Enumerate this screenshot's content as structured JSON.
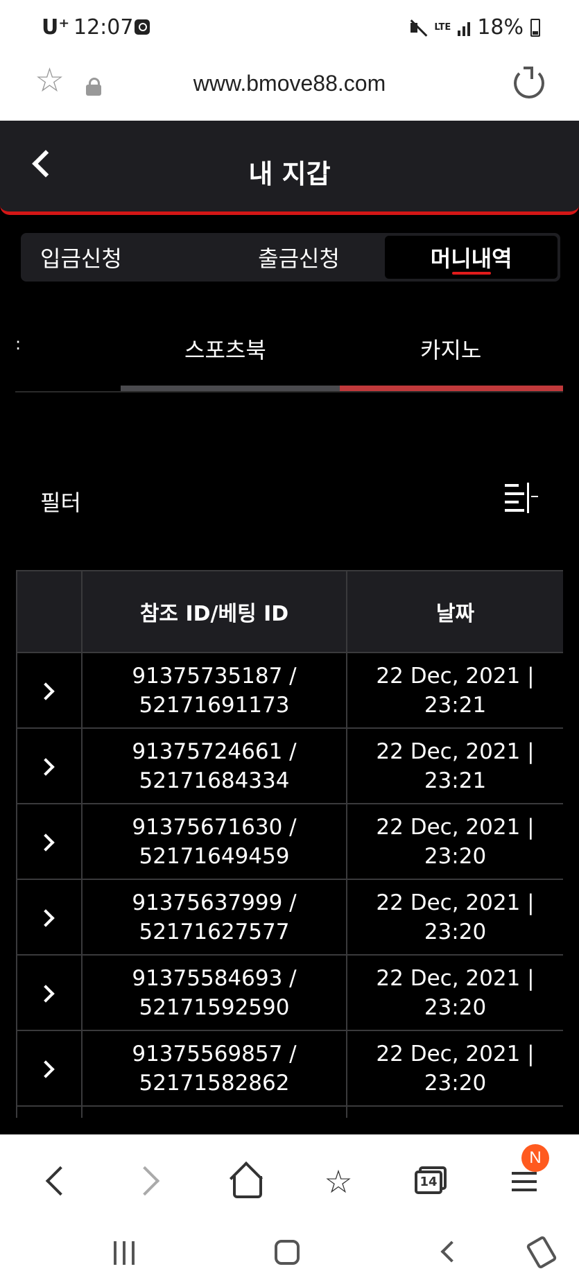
{
  "status_bar": {
    "carrier": "U⁺",
    "time": "12:07",
    "network": "LTE",
    "battery": "18%"
  },
  "url_bar": {
    "url": "www.bmove88.com"
  },
  "header": {
    "title": "내 지갑"
  },
  "tabs": [
    {
      "label": "입금신청",
      "active": false
    },
    {
      "label": "출금신청",
      "active": false
    },
    {
      "label": "머니내역",
      "active": true
    }
  ],
  "sub_tabs": [
    {
      "label": ":",
      "active": false
    },
    {
      "label": "스포츠북",
      "active": false
    },
    {
      "label": "카지노",
      "active": true
    }
  ],
  "filter": {
    "label": "필터"
  },
  "table": {
    "headers": [
      "",
      "참조 ID/베팅 ID",
      "날짜"
    ],
    "rows": [
      {
        "ref_id": "91375735187 /",
        "bet_id": "52171691173",
        "date": "22 Dec, 2021 |",
        "time": "23:21"
      },
      {
        "ref_id": "91375724661 /",
        "bet_id": "52171684334",
        "date": "22 Dec, 2021 |",
        "time": "23:21"
      },
      {
        "ref_id": "91375671630 /",
        "bet_id": "52171649459",
        "date": "22 Dec, 2021 |",
        "time": "23:20"
      },
      {
        "ref_id": "91375637999 /",
        "bet_id": "52171627577",
        "date": "22 Dec, 2021 |",
        "time": "23:20"
      },
      {
        "ref_id": "91375584693 /",
        "bet_id": "52171592590",
        "date": "22 Dec, 2021 |",
        "time": "23:20"
      },
      {
        "ref_id": "91375569857 /",
        "bet_id": "52171582862",
        "date": "22 Dec, 2021 |",
        "time": "23:20"
      }
    ]
  },
  "browser_nav": {
    "tab_count": "14",
    "notification_badge": "N"
  },
  "colors": {
    "accent_red": "#d41616",
    "header_bg": "#1e1e22",
    "page_bg": "#000000",
    "badge_orange": "#ff5a1f"
  }
}
